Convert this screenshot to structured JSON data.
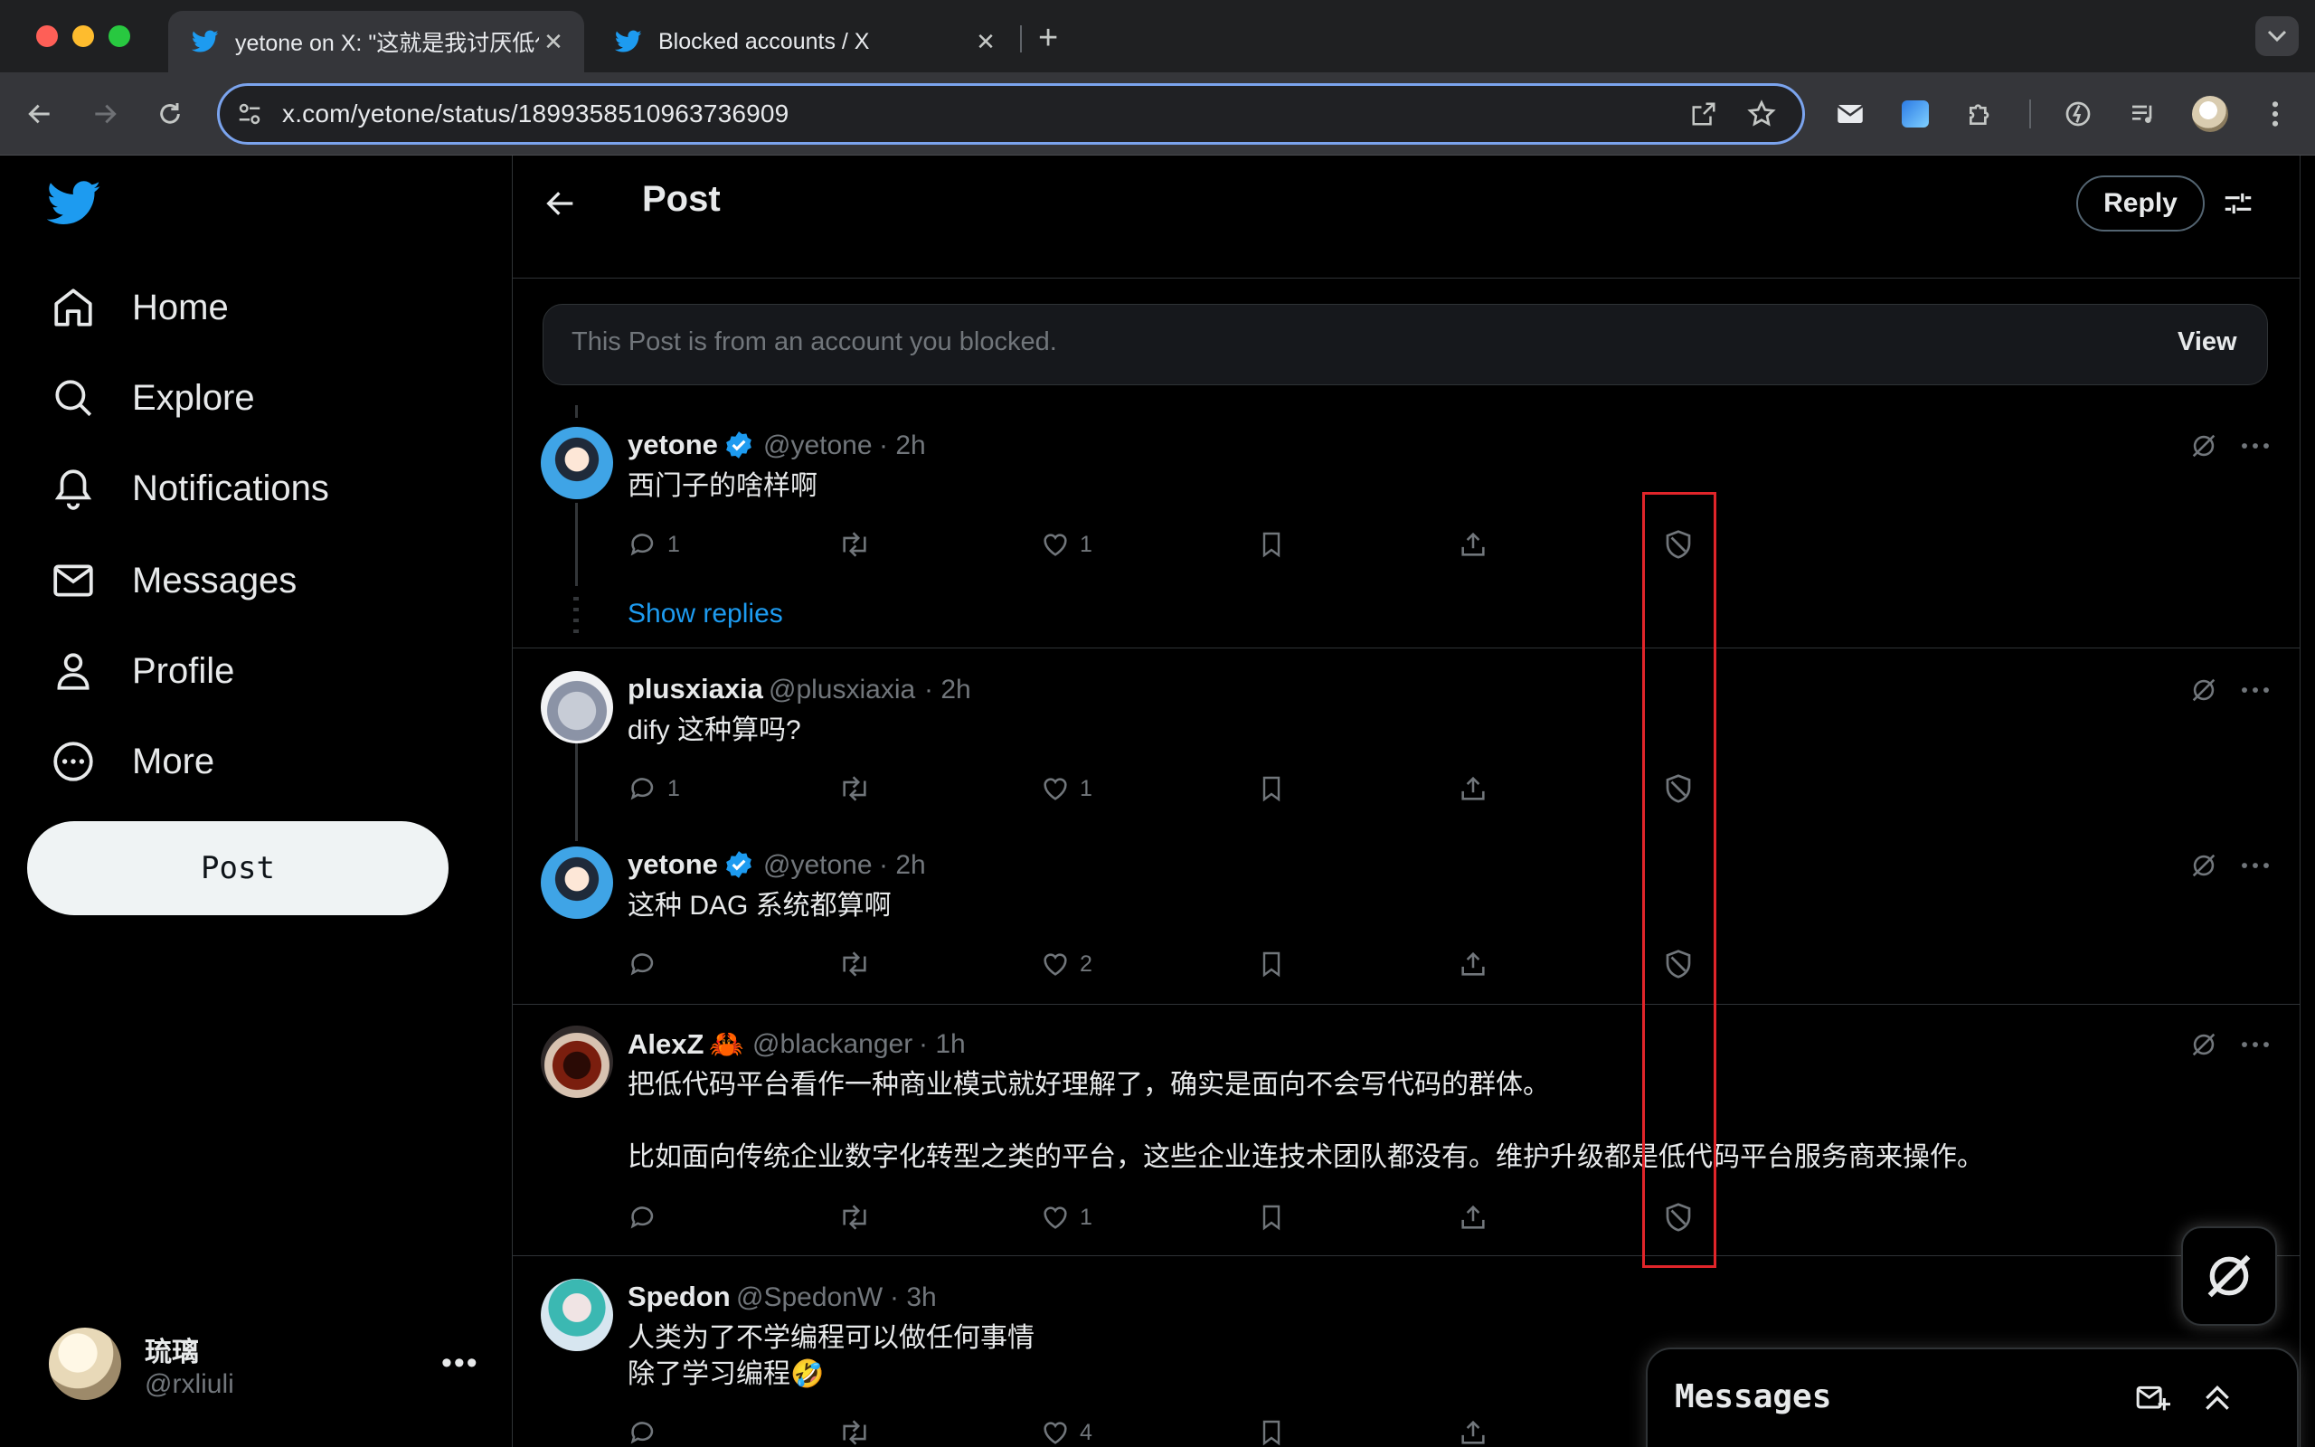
{
  "browser": {
    "tabs": [
      {
        "title": "yetone on X: \"这就是我讨厌低代",
        "active": true
      },
      {
        "title": "Blocked accounts / X",
        "active": false
      }
    ],
    "url": "x.com/yetone/status/1899358510963736909",
    "colors": {
      "accent": "#7ba4ee",
      "tab_active": "#35363a",
      "titlebar": "#1f2022"
    }
  },
  "sidebar": {
    "items": [
      {
        "label": "Home",
        "icon": "home-icon"
      },
      {
        "label": "Explore",
        "icon": "search-icon"
      },
      {
        "label": "Notifications",
        "icon": "bell-icon"
      },
      {
        "label": "Messages",
        "icon": "mail-icon"
      },
      {
        "label": "Profile",
        "icon": "person-icon"
      },
      {
        "label": "More",
        "icon": "more-circle-icon"
      }
    ],
    "post_button": "Post",
    "account": {
      "name": "琉璃",
      "handle": "@rxliuli"
    }
  },
  "header": {
    "title": "Post",
    "reply_button": "Reply"
  },
  "blocked_notice": {
    "text": "This Post is from an account you blocked.",
    "action": "View"
  },
  "replies": [
    {
      "name": "yetone",
      "verified": true,
      "handle": "@yetone",
      "time": "· 2h",
      "text": [
        "西门子的啥样啊"
      ],
      "comments": "1",
      "retweets": "",
      "likes": "1"
    },
    {
      "name": "plusxiaxia",
      "verified": false,
      "handle": "@plusxiaxia",
      "time": "· 2h",
      "text": [
        "dify 这种算吗?"
      ],
      "comments": "1",
      "retweets": "",
      "likes": "1"
    },
    {
      "name": "yetone",
      "verified": true,
      "handle": "@yetone",
      "time": "· 2h",
      "text": [
        "这种 DAG 系统都算啊"
      ],
      "comments": "",
      "retweets": "",
      "likes": "2"
    },
    {
      "name": "AlexZ",
      "emoji": "🦀",
      "verified": false,
      "handle": "@blackanger",
      "time": "· 1h",
      "text": [
        "把低代码平台看作一种商业模式就好理解了，确实是面向不会写代码的群体。",
        "比如面向传统企业数字化转型之类的平台，这些企业连技术团队都没有。维护升级都是低代码平台服务商来操作。"
      ],
      "comments": "",
      "retweets": "",
      "likes": "1"
    },
    {
      "name": "Spedon",
      "verified": false,
      "handle": "@SpedonW",
      "time": "· 3h",
      "text": [
        "人类为了不学编程可以做任何事情",
        "除了学习编程🤣"
      ],
      "comments": "",
      "retweets": "",
      "likes": "4"
    }
  ],
  "show_replies": "Show replies",
  "messages_drawer": {
    "title": "Messages"
  },
  "colors": {
    "link": "#1d9bf0",
    "verified": "#1d9bf0",
    "highlight_box": "#e0252a",
    "muted": "#71767b"
  }
}
